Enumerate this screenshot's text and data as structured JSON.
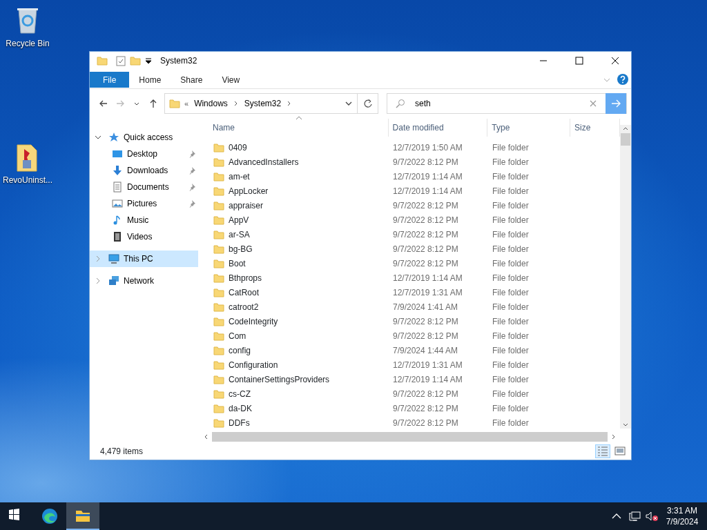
{
  "desktop_icons": [
    {
      "kind": "recycle-bin",
      "label": "Recycle Bin"
    },
    {
      "kind": "app-shortcut",
      "label": "RevoUninst..."
    }
  ],
  "window": {
    "title": "System32",
    "ribbon_tabs": [
      {
        "label": "File",
        "selected": true
      },
      {
        "label": "Home",
        "selected": false
      },
      {
        "label": "Share",
        "selected": false
      },
      {
        "label": "View",
        "selected": false
      }
    ],
    "address": {
      "overflow": "«",
      "path": [
        "Windows",
        "System32"
      ]
    },
    "search": {
      "value": "seth"
    },
    "nav": [
      {
        "kind": "quick-access",
        "label": "Quick access",
        "expanded": true,
        "selected": false,
        "children": [
          {
            "kind": "desktop",
            "label": "Desktop",
            "pinned": true,
            "selected": false
          },
          {
            "kind": "downloads",
            "label": "Downloads",
            "pinned": true,
            "selected": false
          },
          {
            "kind": "documents",
            "label": "Documents",
            "pinned": true,
            "selected": false
          },
          {
            "kind": "pictures",
            "label": "Pictures",
            "pinned": true,
            "selected": false
          },
          {
            "kind": "music",
            "label": "Music",
            "pinned": false,
            "selected": false
          },
          {
            "kind": "videos",
            "label": "Videos",
            "pinned": false,
            "selected": false
          }
        ]
      },
      {
        "kind": "this-pc",
        "label": "This PC",
        "expanded": false,
        "selected": true
      },
      {
        "kind": "network",
        "label": "Network",
        "expanded": false,
        "selected": false
      }
    ],
    "columns": [
      "Name",
      "Date modified",
      "Type",
      "Size"
    ],
    "rows": [
      {
        "name": "0409",
        "date": "12/7/2019 1:50 AM",
        "type": "File folder"
      },
      {
        "name": "AdvancedInstallers",
        "date": "9/7/2022 8:12 PM",
        "type": "File folder"
      },
      {
        "name": "am-et",
        "date": "12/7/2019 1:14 AM",
        "type": "File folder"
      },
      {
        "name": "AppLocker",
        "date": "12/7/2019 1:14 AM",
        "type": "File folder"
      },
      {
        "name": "appraiser",
        "date": "9/7/2022 8:12 PM",
        "type": "File folder"
      },
      {
        "name": "AppV",
        "date": "9/7/2022 8:12 PM",
        "type": "File folder"
      },
      {
        "name": "ar-SA",
        "date": "9/7/2022 8:12 PM",
        "type": "File folder"
      },
      {
        "name": "bg-BG",
        "date": "9/7/2022 8:12 PM",
        "type": "File folder"
      },
      {
        "name": "Boot",
        "date": "9/7/2022 8:12 PM",
        "type": "File folder"
      },
      {
        "name": "Bthprops",
        "date": "12/7/2019 1:14 AM",
        "type": "File folder"
      },
      {
        "name": "CatRoot",
        "date": "12/7/2019 1:31 AM",
        "type": "File folder"
      },
      {
        "name": "catroot2",
        "date": "7/9/2024 1:41 AM",
        "type": "File folder"
      },
      {
        "name": "CodeIntegrity",
        "date": "9/7/2022 8:12 PM",
        "type": "File folder"
      },
      {
        "name": "Com",
        "date": "9/7/2022 8:12 PM",
        "type": "File folder"
      },
      {
        "name": "config",
        "date": "7/9/2024 1:44 AM",
        "type": "File folder"
      },
      {
        "name": "Configuration",
        "date": "12/7/2019 1:31 AM",
        "type": "File folder"
      },
      {
        "name": "ContainerSettingsProviders",
        "date": "12/7/2019 1:14 AM",
        "type": "File folder"
      },
      {
        "name": "cs-CZ",
        "date": "9/7/2022 8:12 PM",
        "type": "File folder"
      },
      {
        "name": "da-DK",
        "date": "9/7/2022 8:12 PM",
        "type": "File folder"
      },
      {
        "name": "DDFs",
        "date": "9/7/2022 8:12 PM",
        "type": "File folder"
      }
    ],
    "status": "4,479 items",
    "views": [
      {
        "kind": "details",
        "selected": true
      },
      {
        "kind": "large-icons",
        "selected": false
      }
    ]
  },
  "taskbar": {
    "apps": [
      {
        "kind": "start",
        "active": false
      },
      {
        "kind": "edge",
        "active": false
      },
      {
        "kind": "explorer",
        "active": true
      }
    ],
    "time": "3:31 AM",
    "date": "7/9/2024"
  }
}
